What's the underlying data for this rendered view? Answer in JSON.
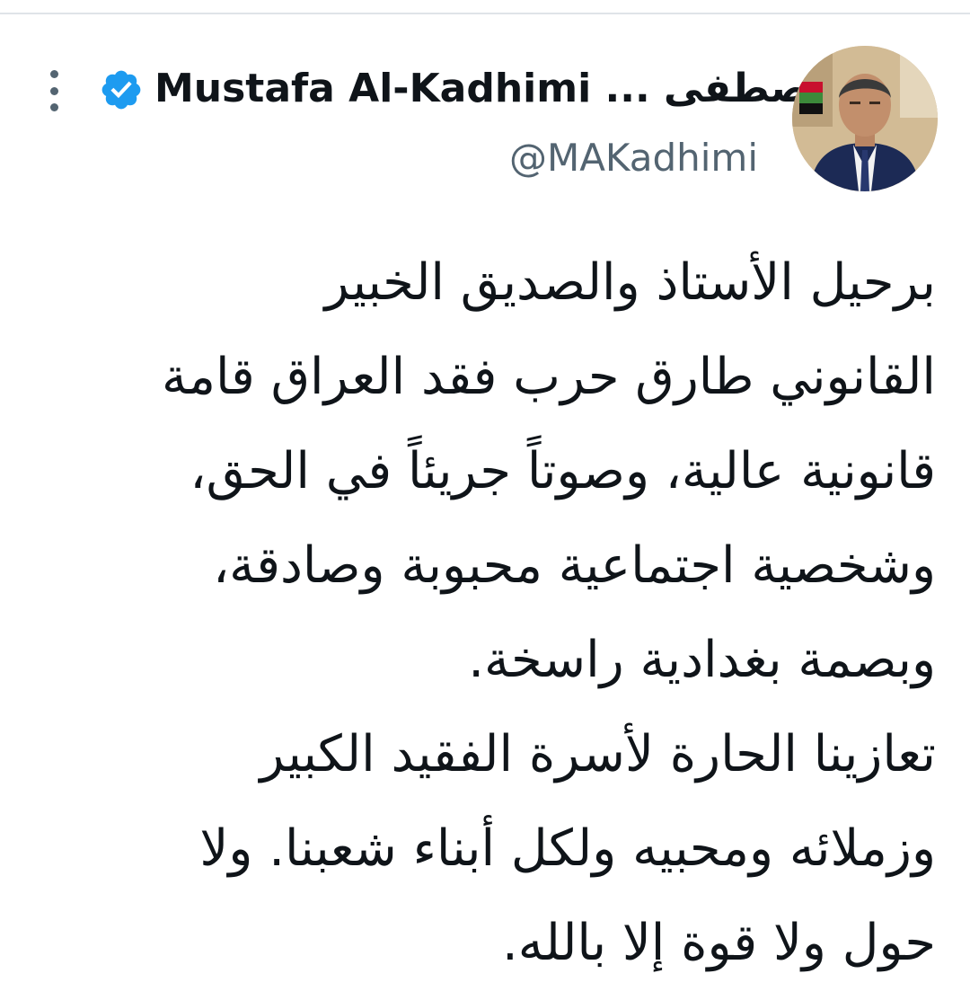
{
  "tweet": {
    "display_name": "Mustafa Al-Kadhimi ... مصطفى",
    "handle": "@MAKadhimi",
    "verified": true,
    "lines": [
      "برحيل الأستاذ والصديق الخبير",
      "القانوني طارق حرب فقد العراق قامة",
      "قانونية عالية، وصوتاً جريئاً في الحق،",
      "وشخصية اجتماعية محبوبة وصادقة،",
      "وبصمة بغدادية راسخة.",
      "تعازينا الحارة لأسرة الفقيد الكبير",
      "وزملائه ومحبيه ولكل أبناء شعبنا. ولا",
      "حول ولا قوة إلا بالله."
    ]
  },
  "icons": {
    "verified": "verified-badge-icon",
    "more": "more-options-icon"
  },
  "colors": {
    "text": "#0f1419",
    "secondary": "#536471",
    "verified_blue": "#1d9bf0",
    "divider": "#dfe4e8"
  }
}
